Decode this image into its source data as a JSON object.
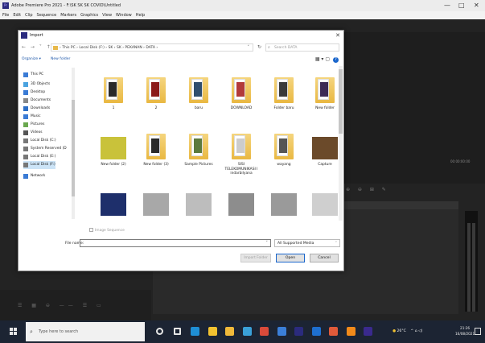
{
  "premiere": {
    "title": "Adobe Premiere Pro 2021 - F:\\SK SK SK COVID\\Untitled",
    "window_controls": [
      "—",
      "□",
      "✕"
    ],
    "menu": [
      "File",
      "Edit",
      "Clip",
      "Sequence",
      "Markers",
      "Graphics",
      "View",
      "Window",
      "Help"
    ],
    "timecode": "00:00:00:00",
    "tool_icons": "⊕ ⊖ ⊞ ✎"
  },
  "dialog": {
    "title": "Import",
    "close_label": "✕",
    "nav_buttons": "← → ˅ ↑",
    "address": "› This PC › Local Disk (F:) › SK › SK › PEKANAN › DATA ›",
    "search_placeholder": "Search DATA",
    "organize_label": "Organize ▾",
    "new_folder_label": "New folder",
    "nav_items": [
      {
        "label": "This PC",
        "icon": "pc-icon",
        "color": "#3a7bd5"
      },
      {
        "label": "3D Objects",
        "icon": "cube-icon",
        "color": "#4aa3df"
      },
      {
        "label": "Desktop",
        "icon": "desktop-icon",
        "color": "#3a7bd5"
      },
      {
        "label": "Documents",
        "icon": "document-icon",
        "color": "#888888"
      },
      {
        "label": "Downloads",
        "icon": "download-icon",
        "color": "#2d6fc6"
      },
      {
        "label": "Music",
        "icon": "music-icon",
        "color": "#3a7bd5"
      },
      {
        "label": "Pictures",
        "icon": "pictures-icon",
        "color": "#6aa84f"
      },
      {
        "label": "Videos",
        "icon": "video-icon",
        "color": "#555555"
      },
      {
        "label": "Local Disk (C:)",
        "icon": "drive-icon",
        "color": "#777777"
      },
      {
        "label": "System Reserved (D",
        "icon": "drive-icon",
        "color": "#777777"
      },
      {
        "label": "Local Disk (E:)",
        "icon": "drive-icon",
        "color": "#777777"
      },
      {
        "label": "Local Disk (F:)",
        "icon": "drive-icon",
        "color": "#777777"
      },
      {
        "label": "Network",
        "icon": "network-icon",
        "color": "#3a7bd5"
      }
    ],
    "files": [
      {
        "name": "1",
        "kind": "folder-img",
        "img": "#2a2a2a"
      },
      {
        "name": "2",
        "kind": "folder-img",
        "img": "#8b1a1a"
      },
      {
        "name": "baru",
        "kind": "folder-img",
        "img": "#2f4e6e"
      },
      {
        "name": "DOWNLOAD",
        "kind": "folder-img",
        "img": "#b23a3a"
      },
      {
        "name": "Folder baru",
        "kind": "folder-img",
        "img": "#3a3a3a"
      },
      {
        "name": "New folder",
        "kind": "folder-img",
        "img": "#3d2a55"
      },
      {
        "name": "New folder (2)",
        "kind": "photo",
        "img": "#c9c23a"
      },
      {
        "name": "New folder (3)",
        "kind": "folder-img",
        "img": "#2a2a2a"
      },
      {
        "name": "Sample Pictures",
        "kind": "folder-img",
        "img": "#5c7a3d"
      },
      {
        "name": "SISI TELEKOMUNIKASI I indarbilyana",
        "kind": "folder-doc",
        "img": "#cccccc"
      },
      {
        "name": "wayang",
        "kind": "folder-img",
        "img": "#555555"
      },
      {
        "name": "Capture",
        "kind": "photo",
        "img": "#6b4a2a"
      },
      {
        "name": "",
        "kind": "photo",
        "img": "#1e2f6b"
      },
      {
        "name": "",
        "kind": "photo",
        "img": "#a8a8a8"
      },
      {
        "name": "",
        "kind": "photo",
        "img": "#bdbdbd"
      },
      {
        "name": "",
        "kind": "photo",
        "img": "#8d8d8d"
      },
      {
        "name": "",
        "kind": "photo",
        "img": "#9a9a9a"
      },
      {
        "name": "",
        "kind": "photo",
        "img": "#cfcfcf"
      }
    ],
    "image_sequence_label": "Image Sequence",
    "file_name_label": "File name:",
    "file_name_value": "",
    "file_type": "All Supported Media",
    "import_folder_label": "Import Folder",
    "open_label": "Open",
    "cancel_label": "Cancel"
  },
  "taskbar": {
    "search_placeholder": "Type here to search",
    "apps": [
      {
        "icon": "cortana-icon",
        "color": "#e6e6e6"
      },
      {
        "icon": "task-view-icon",
        "color": "#e6e6e6"
      },
      {
        "icon": "edge-icon",
        "color": "#1f8fd6"
      },
      {
        "icon": "store-icon",
        "color": "#f2c230"
      },
      {
        "icon": "file-explorer-icon",
        "color": "#f0b93a"
      },
      {
        "icon": "mail-icon",
        "color": "#3aa0d8"
      },
      {
        "icon": "chrome-icon",
        "color": "#d94a3a"
      },
      {
        "icon": "browser-icon",
        "color": "#3b7fd9"
      },
      {
        "icon": "premiere-icon",
        "color": "#2b2b7e"
      },
      {
        "icon": "app-icon",
        "color": "#1e6fd0"
      },
      {
        "icon": "media-icon",
        "color": "#e05a3a"
      },
      {
        "icon": "vlc-icon",
        "color": "#f28a1a"
      },
      {
        "icon": "after-effects-icon",
        "color": "#3a2a8e"
      }
    ],
    "weather": "26°C",
    "tray_icons": "^ ⌂ ◁)",
    "time": "21:26",
    "date": "16/08/2021"
  }
}
